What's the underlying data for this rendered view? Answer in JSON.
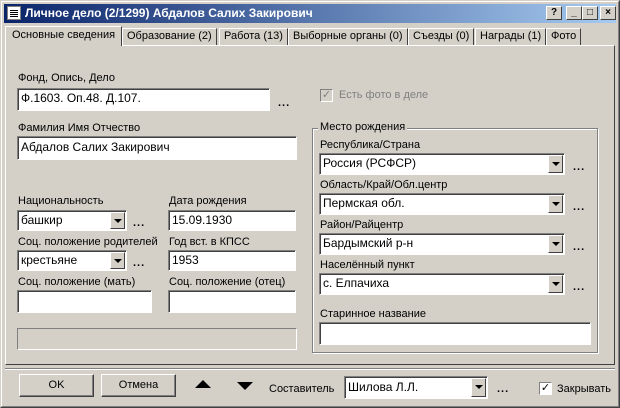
{
  "window": {
    "title": "Личное дело (2/1299) Абдалов Салих Закирович",
    "buttons": {
      "help": "?",
      "minimize": "_",
      "maximize": "□",
      "close": "×"
    }
  },
  "tabs": [
    {
      "label": "Основные сведения"
    },
    {
      "label": "Образование (2)"
    },
    {
      "label": "Работа (13)"
    },
    {
      "label": "Выборные органы (0)"
    },
    {
      "label": "Съезды (0)"
    },
    {
      "label": "Награды (1)"
    },
    {
      "label": "Фото"
    }
  ],
  "form": {
    "fond": {
      "label": "Фонд, Опись, Дело",
      "value": "Ф.1603. Оп.48. Д.107."
    },
    "fio": {
      "label": "Фамилия Имя Отчество",
      "value": "Абдалов Салих Закирович"
    },
    "nationality": {
      "label": "Национальность",
      "value": "башкир"
    },
    "birth_date": {
      "label": "Дата рождения",
      "value": "15.09.1930"
    },
    "parents_status": {
      "label": "Соц. положение родителей",
      "value": "крестьяне"
    },
    "party_year": {
      "label": "Год вст. в КПСС",
      "value": "1953"
    },
    "mother_status": {
      "label": "Соц. положение (мать)",
      "value": ""
    },
    "father_status": {
      "label": "Соц. положение (отец)",
      "value": ""
    },
    "photo_flag": {
      "label": "Есть фото в деле",
      "checked": true
    }
  },
  "birthplace": {
    "title": "Место рождения",
    "republic": {
      "label": "Республика/Страна",
      "value": "Россия (РСФСР)"
    },
    "region": {
      "label": "Область/Край/Обл.центр",
      "value": "Пермская обл."
    },
    "district": {
      "label": "Район/Райцентр",
      "value": "Бардымский р-н"
    },
    "settlement": {
      "label": "Населённый пункт",
      "value": "с. Елпачиха"
    },
    "old_name": {
      "label": "Старинное название",
      "value": ""
    }
  },
  "footer": {
    "ok": "OK",
    "cancel": "Отмена",
    "compiler_label": "Составитель",
    "compiler_value": "Шилова Л.Л.",
    "close_check_label": "Закрывать",
    "close_check_checked": true
  },
  "ellipsis": "..."
}
